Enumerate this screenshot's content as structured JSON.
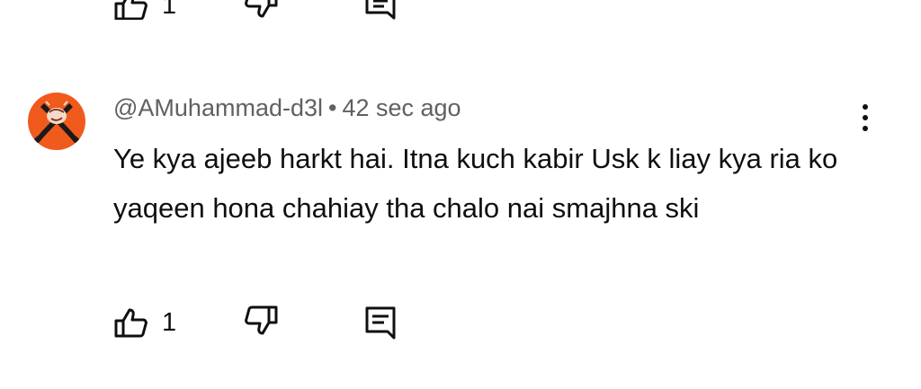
{
  "top_actions": {
    "like_count": "1"
  },
  "comment": {
    "author": "@AMuhammad-d3l",
    "separator": "•",
    "timestamp": "42 sec ago",
    "text": "Ye kya ajeeb harkt hai. Itna kuch kabir Usk k liay kya ria ko yaqeen hona chahiay tha chalo nai smajhna ski",
    "avatar_icon": "crossed-swords-logo-icon",
    "avatar_color": "#f05a1c",
    "like_count": "1",
    "icons": {
      "like": "thumbs-up-icon",
      "dislike": "thumbs-down-icon",
      "reply": "comment-icon",
      "menu": "more-vertical-icon"
    }
  }
}
